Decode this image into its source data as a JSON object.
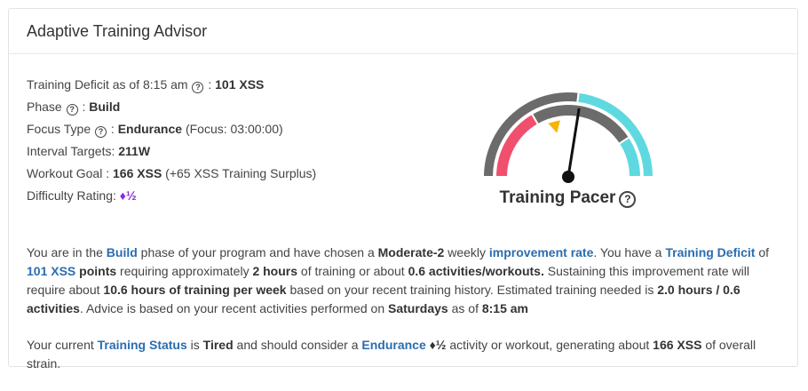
{
  "card": {
    "title": "Adaptive Training Advisor"
  },
  "stats": {
    "deficit_label": "Training Deficit as of 8:15 am",
    "deficit_sep": ":",
    "deficit_value": "101 XSS",
    "phase_label": "Phase",
    "phase_sep": ":",
    "phase_value": "Build",
    "focus_label": "Focus Type",
    "focus_sep": ":",
    "focus_value": "Endurance",
    "focus_detail": "(Focus: 03:00:00)",
    "interval_label": "Interval Targets:",
    "interval_value": "211W",
    "goal_label": "Workout Goal :",
    "goal_value": "166 XSS",
    "goal_detail": "(+65 XSS Training Surplus)",
    "difficulty_label": "Difficulty Rating:",
    "difficulty_value": "♦½"
  },
  "help_icon_glyph": "?",
  "gauge": {
    "label": "Training Pacer",
    "colors": {
      "red": "#f0506e",
      "gray": "#6b6b6b",
      "cyan": "#5fd9e0",
      "pointer": "#f5b400",
      "needle": "#111111"
    },
    "needle_fraction": 0.55,
    "pointer_fraction": 0.42
  },
  "advice": {
    "p1": {
      "t1": "You are in the ",
      "phase": "Build",
      "t2": " phase of your program and have chosen a ",
      "rate_name": "Moderate-2",
      "t3": " weekly ",
      "rate_link": "improvement rate",
      "t4": ". You have a ",
      "deficit_link": "Training Deficit",
      "t5": " of ",
      "deficit_value": "101 XSS",
      "t6": " points",
      "t7": " requiring approximately ",
      "hours": "2 hours",
      "t8": " of training or about ",
      "activities": "0.6 activities/workouts.",
      "t9": " Sustaining this improvement rate will require about ",
      "weekly": "10.6 hours of training per week",
      "t10": " based on your recent training history. Estimated training needed is ",
      "needed": "2.0 hours / 0.6 activities",
      "t11": ". Advice is based on your recent activities performed on ",
      "day": "Saturdays",
      "t12": " as of ",
      "time": "8:15 am"
    },
    "p2": {
      "t1": "Your current ",
      "status_link": "Training Status",
      "t2": " is ",
      "status": "Tired",
      "t3": " and should consider a ",
      "focus_link": "Endurance",
      "difficulty": "♦½",
      "t4": " activity or workout, generating about ",
      "xss": "166 XSS",
      "t5": " of overall strain."
    }
  }
}
